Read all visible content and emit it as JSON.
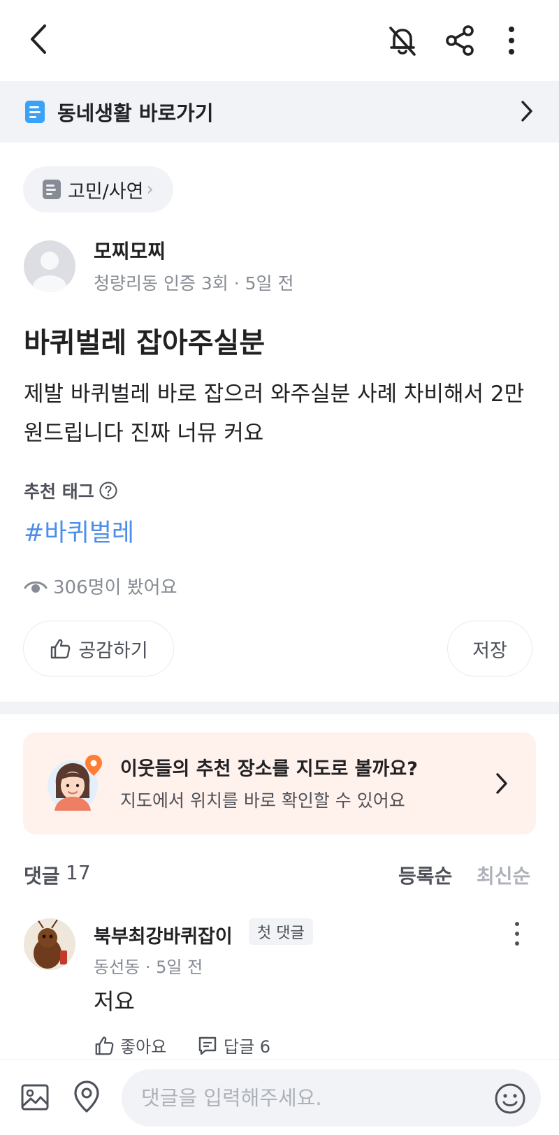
{
  "header": {
    "back_icon": "chevron-left-icon",
    "bell_icon": "bell-off-icon",
    "share_icon": "share-icon",
    "more_icon": "more-vertical-icon"
  },
  "banner": {
    "label": "동네생활 바로가기",
    "icon": "document-icon",
    "accent": "#3ba3f7"
  },
  "category": {
    "label": "고민/사연",
    "chevron": "›"
  },
  "author": {
    "name": "모찌모찌",
    "meta": "청량리동 인증 3회 · 5일 전"
  },
  "post": {
    "title": "바퀴벌레 잡아주실분",
    "body": "제발 바퀴벌레 바로 잡으러 와주실분 사례 차비해서 2만원드립니다 진짜 너뮤 커요"
  },
  "tags": {
    "heading": "추천 태그",
    "help_icon": "question-circle-icon",
    "items": [
      "#바퀴벌레"
    ],
    "color": "#4d8fe8"
  },
  "views": {
    "text": "306명이 봤어요",
    "icon": "eye-icon"
  },
  "actions": {
    "like_label": "공감하기",
    "like_icon": "thumbs-up-icon",
    "save_label": "저장"
  },
  "promo": {
    "title": "이웃들의 추천 장소를 지도로 볼까요?",
    "subtitle": "지도에서 위치를 바로 확인할 수 있어요",
    "bg": "#fff1ec",
    "pin_color": "#ff7e36"
  },
  "comments": {
    "label": "댓글",
    "count": "17",
    "sort_registered": "등록순",
    "sort_newest": "최신순",
    "items": [
      {
        "name": "북부최강바퀴잡이",
        "badge": "첫 댓글",
        "meta": "동선동 · 5일 전",
        "text": "저요",
        "like_label": "좋아요",
        "reply_label": "답글 6"
      }
    ]
  },
  "composer": {
    "placeholder": "댓글을 입력해주세요.",
    "image_icon": "image-icon",
    "location_icon": "location-pin-icon",
    "emoji_icon": "smiley-icon"
  }
}
